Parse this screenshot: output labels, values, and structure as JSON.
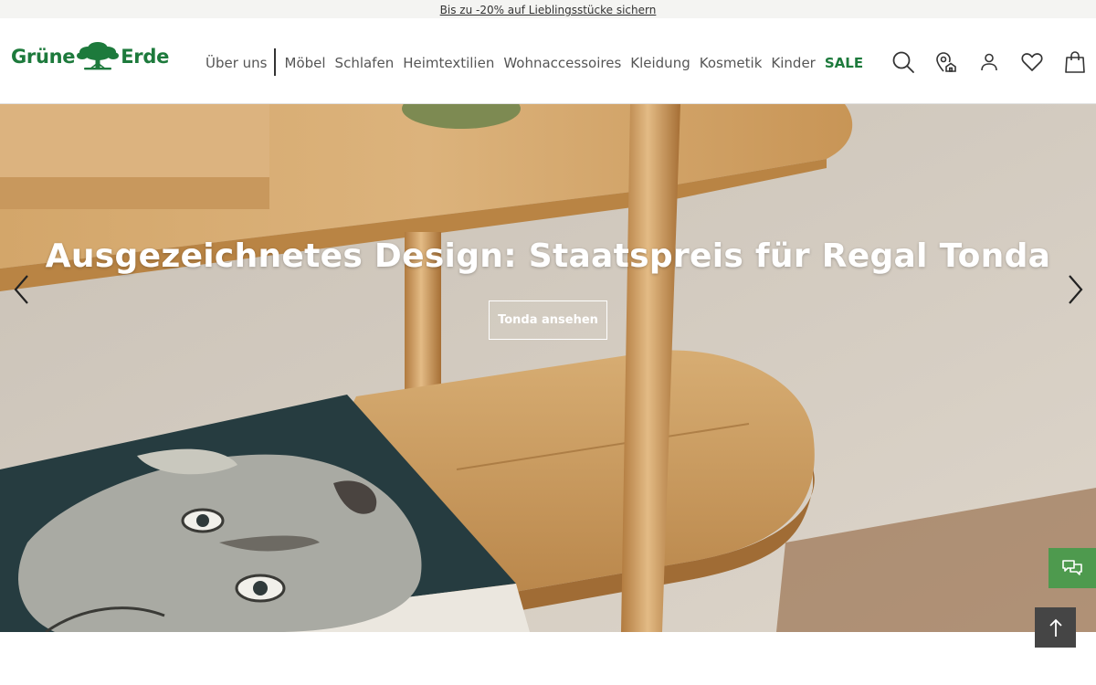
{
  "promo": {
    "text": "Bis zu -20% auf Lieblingsstücke sichern"
  },
  "logo": {
    "word_left": "Grüne",
    "word_right": "Erde",
    "color": "#1d7a3c"
  },
  "nav": {
    "items": [
      "Über uns",
      "Möbel",
      "Schlafen",
      "Heimtextilien",
      "Wohnaccessoires",
      "Kleidung",
      "Kosmetik",
      "Kinder"
    ],
    "sale_label": "SALE",
    "sale_color": "#1d7a3c"
  },
  "header_icons": [
    "search-icon",
    "store-locator-icon",
    "account-icon",
    "wishlist-heart-icon",
    "shopping-bag-icon"
  ],
  "hero": {
    "title": "Ausgezeichnetes Design: Staatspreis für Regal Tonda",
    "cta_label": "Tonda ansehen",
    "prev_icon": "chevron-left-icon",
    "next_icon": "chevron-right-icon"
  },
  "floating": {
    "chat_icon": "chat-bubbles-icon",
    "chat_color": "#4e9a4e",
    "back_to_top_icon": "arrow-up-icon",
    "back_to_top_color": "#454545"
  }
}
